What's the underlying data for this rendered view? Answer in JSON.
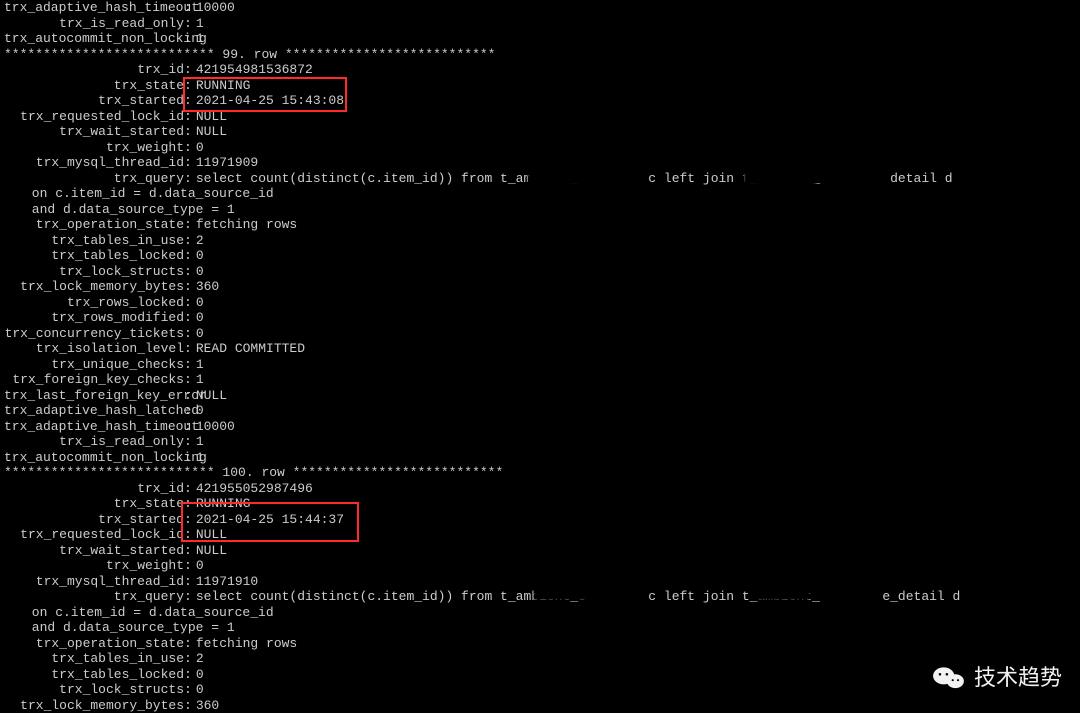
{
  "partial_top": [
    {
      "label": "trx_adaptive_hash_timeout",
      "value": "10000"
    },
    {
      "label": "trx_is_read_only",
      "value": "1"
    },
    {
      "label": "trx_autocommit_non_locking",
      "value": "1"
    }
  ],
  "row99": {
    "separator": "*************************** 99. row ***************************",
    "fields": [
      {
        "label": "trx_id",
        "value": "421954981536872"
      },
      {
        "label": "trx_state",
        "value": "RUNNING"
      },
      {
        "label": "trx_started",
        "value": "2021-04-25 15:43:08"
      },
      {
        "label": "trx_requested_lock_id",
        "value": "NULL"
      },
      {
        "label": "trx_wait_started",
        "value": "NULL"
      },
      {
        "label": "trx_weight",
        "value": "0"
      },
      {
        "label": "trx_mysql_thread_id",
        "value": "11971909"
      }
    ],
    "query_label": "trx_query",
    "query_line": "select count(distinct(c.item_id)) from t_ambient_         c left join t_ambient_         detail d",
    "query_cont1": " on c.item_id = d.data_source_id",
    "query_cont2": " and d.data_source_type = 1",
    "fields2": [
      {
        "label": "trx_operation_state",
        "value": "fetching rows"
      },
      {
        "label": "trx_tables_in_use",
        "value": "2"
      },
      {
        "label": "trx_tables_locked",
        "value": "0"
      },
      {
        "label": "trx_lock_structs",
        "value": "0"
      },
      {
        "label": "trx_lock_memory_bytes",
        "value": "360"
      },
      {
        "label": "trx_rows_locked",
        "value": "0"
      },
      {
        "label": "trx_rows_modified",
        "value": "0"
      },
      {
        "label": "trx_concurrency_tickets",
        "value": "0"
      },
      {
        "label": "trx_isolation_level",
        "value": "READ COMMITTED"
      },
      {
        "label": "trx_unique_checks",
        "value": "1"
      },
      {
        "label": "trx_foreign_key_checks",
        "value": "1"
      },
      {
        "label": "trx_last_foreign_key_error",
        "value": "NULL"
      },
      {
        "label": "trx_adaptive_hash_latched",
        "value": "0"
      },
      {
        "label": "trx_adaptive_hash_timeout",
        "value": "10000"
      },
      {
        "label": "trx_is_read_only",
        "value": "1"
      },
      {
        "label": "trx_autocommit_non_locking",
        "value": "1"
      }
    ]
  },
  "row100": {
    "separator": "*************************** 100. row ***************************",
    "fields": [
      {
        "label": "trx_id",
        "value": "421955052987496"
      },
      {
        "label": "trx_state",
        "value": "RUNNING"
      },
      {
        "label": "trx_started",
        "value": "2021-04-25 15:44:37"
      },
      {
        "label": "trx_requested_lock_id",
        "value": "NULL"
      },
      {
        "label": "trx_wait_started",
        "value": "NULL"
      },
      {
        "label": "trx_weight",
        "value": "0"
      },
      {
        "label": "trx_mysql_thread_id",
        "value": "11971910"
      }
    ],
    "query_label": "trx_query",
    "query_line": "select count(distinct(c.item_id)) from t_ambient_c        c left join t_ambient_        e_detail d",
    "query_cont1": " on c.item_id = d.data_source_id",
    "query_cont2": " and d.data_source_type = 1",
    "fields2": [
      {
        "label": "trx_operation_state",
        "value": "fetching rows"
      },
      {
        "label": "trx_tables_in_use",
        "value": "2"
      },
      {
        "label": "trx_tables_locked",
        "value": "0"
      },
      {
        "label": "trx_lock_structs",
        "value": "0"
      },
      {
        "label": "trx_lock_memory_bytes",
        "value": "360"
      }
    ]
  },
  "watermark": "技术趋势"
}
